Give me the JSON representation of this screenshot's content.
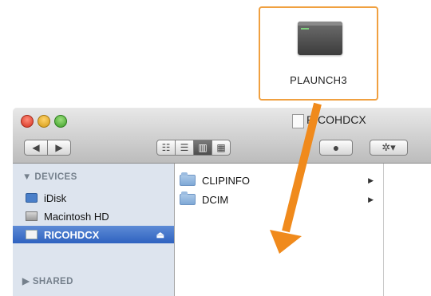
{
  "callout": {
    "file_name": "PLAUNCH3",
    "border_color": "#f0a040"
  },
  "window": {
    "title": "RICOHDCX",
    "toolbar": {
      "back_icon": "◀",
      "forward_icon": "▶",
      "view_icon": "☷",
      "view_list": "☰",
      "view_column": "▥",
      "view_flow": "▦",
      "quicklook_icon": "●",
      "action_icon": "✲▾"
    }
  },
  "sidebar": {
    "devices_header": "▼ DEVICES",
    "items": [
      {
        "label": "iDisk",
        "icon": "idisk-icon"
      },
      {
        "label": "Macintosh HD",
        "icon": "hard-disk-icon"
      },
      {
        "label": "RICOHDCX",
        "icon": "memory-card-icon",
        "selected": true
      }
    ],
    "eject_icon": "⏏",
    "shared_header": "▶ SHARED"
  },
  "files": [
    {
      "name": "CLIPINFO",
      "disclosure": "▶"
    },
    {
      "name": "DCIM",
      "disclosure": "▶"
    }
  ],
  "colors": {
    "arrow": "#f08a1c",
    "selection": "#3a6cc8"
  }
}
